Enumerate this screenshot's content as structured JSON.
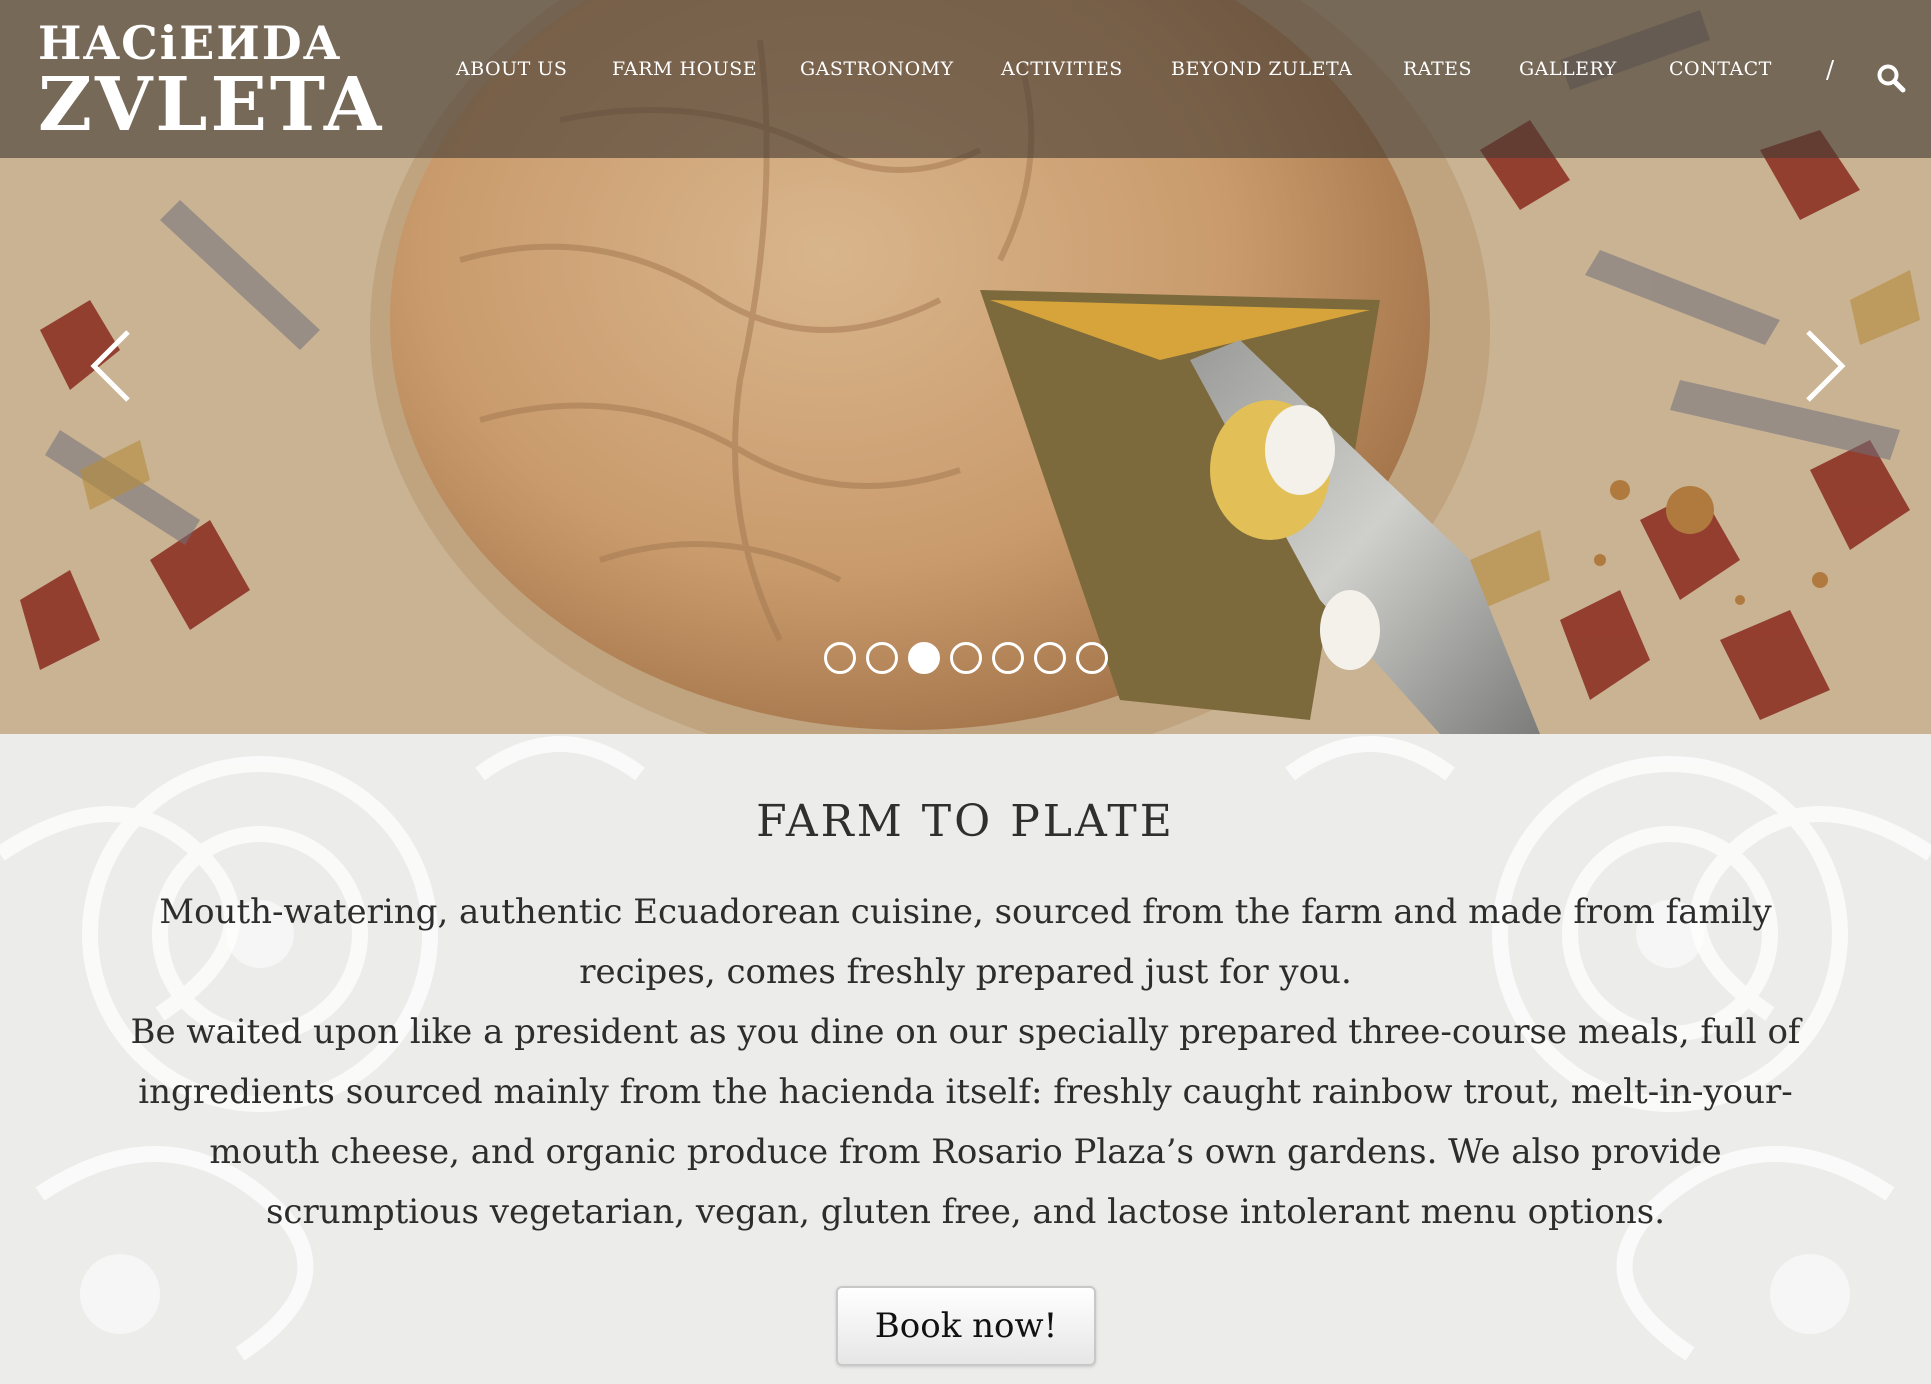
{
  "brand": {
    "logo_line1": "HACiEИDA",
    "logo_line2": "ZVLETA"
  },
  "nav": {
    "items": [
      {
        "label": "ABOUT US"
      },
      {
        "label": "FARM HOUSE"
      },
      {
        "label": "GASTRONOMY"
      },
      {
        "label": "ACTIVITIES"
      },
      {
        "label": "BEYOND ZULETA"
      },
      {
        "label": "RATES"
      },
      {
        "label": "GALLERY"
      },
      {
        "label": "CONTACT"
      }
    ],
    "separator": "/",
    "search_icon": "search-icon"
  },
  "carousel": {
    "slide_count": 7,
    "active_index": 2,
    "prev_icon": "chevron-left-icon",
    "next_icon": "chevron-right-icon"
  },
  "section": {
    "title": "FARM TO PLATE",
    "paragraph1": "Mouth-watering, authentic Ecuadorean cuisine, sourced from the farm and made from family recipes, comes freshly prepared just for you.",
    "paragraph2": "Be waited upon like a president as you dine on our specially prepared three-course meals, full of ingredients sourced mainly from the hacienda itself: freshly caught rainbow trout, melt-in-your-mouth cheese, and organic produce from Rosario Plaza’s own gardens. We also provide scrumptious vegetarian, vegan, gluten free, and lactose intolerant menu options."
  },
  "cta": {
    "book_label": "Book now!"
  },
  "colors": {
    "header_overlay": "#463c34",
    "content_bg": "#ececea",
    "text": "#2d2d2d"
  }
}
